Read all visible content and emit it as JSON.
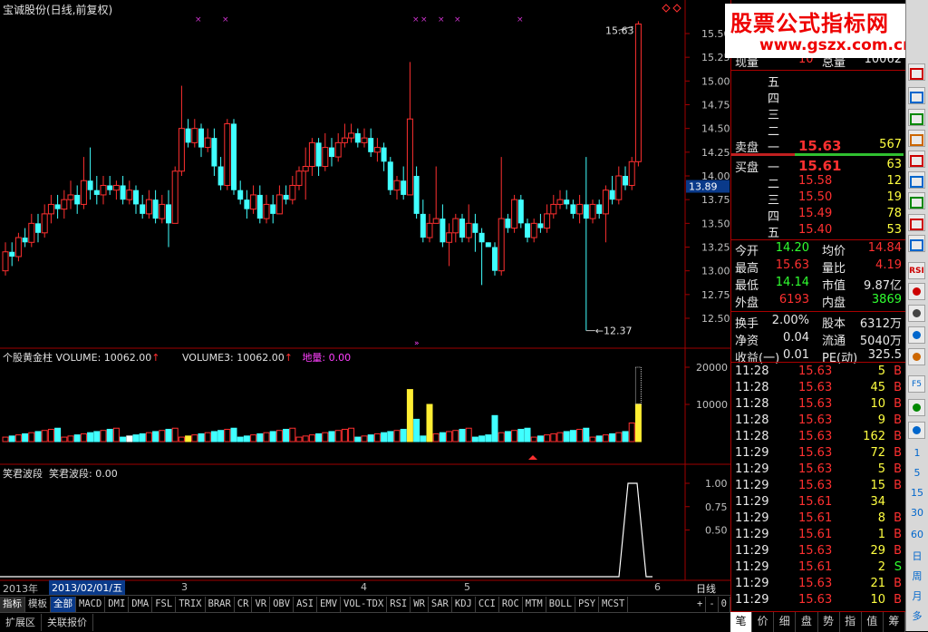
{
  "window": {
    "title": "宝诚股份(日线,前复权)",
    "cycle": "日线"
  },
  "watermark": {
    "title": "股票公式指标网",
    "url": "www.gszx.com.cn"
  },
  "main_chart": {
    "price_axis": [
      "15.50",
      "15.25",
      "15.00",
      "14.75",
      "14.50",
      "14.25",
      "14.00",
      "13.75",
      "13.50",
      "13.25",
      "13.00",
      "12.75",
      "12.50"
    ],
    "current_price": "13.89",
    "high_label": "15.63",
    "low_label": "12.37"
  },
  "volume_panel": {
    "indicator": "个股黄金柱",
    "volume_label": "VOLUME: 10062.00",
    "volume3_label": "VOLUME3: 10062.00",
    "ground_label": "地量: 0.00",
    "axis": [
      "20000",
      "10000"
    ]
  },
  "indicator_panel": {
    "name": "笑君波段",
    "value_label": "笑君波段: 0.00",
    "axis": [
      "1.00",
      "0.75",
      "0.50"
    ]
  },
  "date_bar": {
    "year": "2013年",
    "cursor_date": "2013/02/01/五",
    "months": [
      "3",
      "4",
      "5",
      "6"
    ]
  },
  "indicator_tabs": [
    "指标",
    "模板",
    "全部",
    "MACD",
    "DMI",
    "DMA",
    "FSL",
    "TRIX",
    "BRAR",
    "CR",
    "VR",
    "OBV",
    "ASI",
    "EMV",
    "VOL-TDX",
    "RSI",
    "WR",
    "SAR",
    "KDJ",
    "CCI",
    "ROC",
    "MTM",
    "BOLL",
    "PSY",
    "MCST"
  ],
  "tab_controls": [
    "+",
    "-",
    "0"
  ],
  "ext_tabs": [
    "扩展区",
    "关联报价"
  ],
  "quote": {
    "now_vol_label": "现量",
    "now_vol": "10",
    "total_vol_label": "总量",
    "total_vol": "10062",
    "asks": [
      {
        "label": "五",
        "price": "",
        "vol": ""
      },
      {
        "label": "四",
        "price": "",
        "vol": ""
      },
      {
        "label": "三",
        "price": "",
        "vol": ""
      },
      {
        "label": "二",
        "price": "",
        "vol": ""
      },
      {
        "label": "一",
        "price": "15.63",
        "vol": "567"
      }
    ],
    "sell_label": "卖盘",
    "buy_label": "买盘",
    "bids": [
      {
        "label": "一",
        "price": "15.61",
        "vol": "63"
      },
      {
        "label": "二",
        "price": "15.58",
        "vol": "12"
      },
      {
        "label": "三",
        "price": "15.50",
        "vol": "19"
      },
      {
        "label": "四",
        "price": "15.49",
        "vol": "78"
      },
      {
        "label": "五",
        "price": "15.40",
        "vol": "53"
      }
    ],
    "stats": [
      {
        "l1": "今开",
        "v1": "14.20",
        "c1": "green",
        "l2": "均价",
        "v2": "14.84",
        "c2": "red"
      },
      {
        "l1": "最高",
        "v1": "15.63",
        "c1": "red",
        "l2": "量比",
        "v2": "4.19",
        "c2": "red"
      },
      {
        "l1": "最低",
        "v1": "14.14",
        "c1": "green",
        "l2": "市值",
        "v2": "9.87亿",
        "c2": "white"
      },
      {
        "l1": "外盘",
        "v1": "6193",
        "c1": "red",
        "l2": "内盘",
        "v2": "3869",
        "c2": "green"
      },
      {
        "l1": "换手",
        "v1": "2.00%",
        "c1": "white",
        "l2": "股本",
        "v2": "6312万",
        "c2": "white"
      },
      {
        "l1": "净资",
        "v1": "0.04",
        "c1": "white",
        "l2": "流通",
        "v2": "5040万",
        "c2": "white"
      },
      {
        "l1": "收益(一)",
        "v1": "0.01",
        "c1": "white",
        "l2": "PE(动)",
        "v2": "325.5",
        "c2": "white"
      }
    ],
    "ticks": [
      {
        "t": "11:28",
        "p": "15.63",
        "v": "5",
        "f": "B"
      },
      {
        "t": "11:28",
        "p": "15.63",
        "v": "45",
        "f": "B"
      },
      {
        "t": "11:28",
        "p": "15.63",
        "v": "10",
        "f": "B"
      },
      {
        "t": "11:28",
        "p": "15.63",
        "v": "9",
        "f": "B"
      },
      {
        "t": "11:28",
        "p": "15.63",
        "v": "162",
        "f": "B"
      },
      {
        "t": "11:29",
        "p": "15.63",
        "v": "72",
        "f": "B"
      },
      {
        "t": "11:29",
        "p": "15.63",
        "v": "5",
        "f": "B"
      },
      {
        "t": "11:29",
        "p": "15.63",
        "v": "15",
        "f": "B"
      },
      {
        "t": "11:29",
        "p": "15.61",
        "v": "34",
        "f": ""
      },
      {
        "t": "11:29",
        "p": "15.61",
        "v": "8",
        "f": "B"
      },
      {
        "t": "11:29",
        "p": "15.61",
        "v": "1",
        "f": "B"
      },
      {
        "t": "11:29",
        "p": "15.63",
        "v": "29",
        "f": "B"
      },
      {
        "t": "11:29",
        "p": "15.61",
        "v": "2",
        "f": "S"
      },
      {
        "t": "11:29",
        "p": "15.63",
        "v": "21",
        "f": "B"
      },
      {
        "t": "11:29",
        "p": "15.63",
        "v": "10",
        "f": "B"
      }
    ]
  },
  "bottom_tabs": [
    "笔",
    "价",
    "细",
    "盘",
    "势",
    "指",
    "值",
    "筹"
  ],
  "toolbar": [
    "RSI",
    "F5",
    "1",
    "5",
    "15",
    "30",
    "60",
    "日",
    "周",
    "月",
    "多"
  ],
  "colors": {
    "up": "#ff3030",
    "down": "#40ffff",
    "bg": "#000000",
    "grid": "#a00000"
  }
}
